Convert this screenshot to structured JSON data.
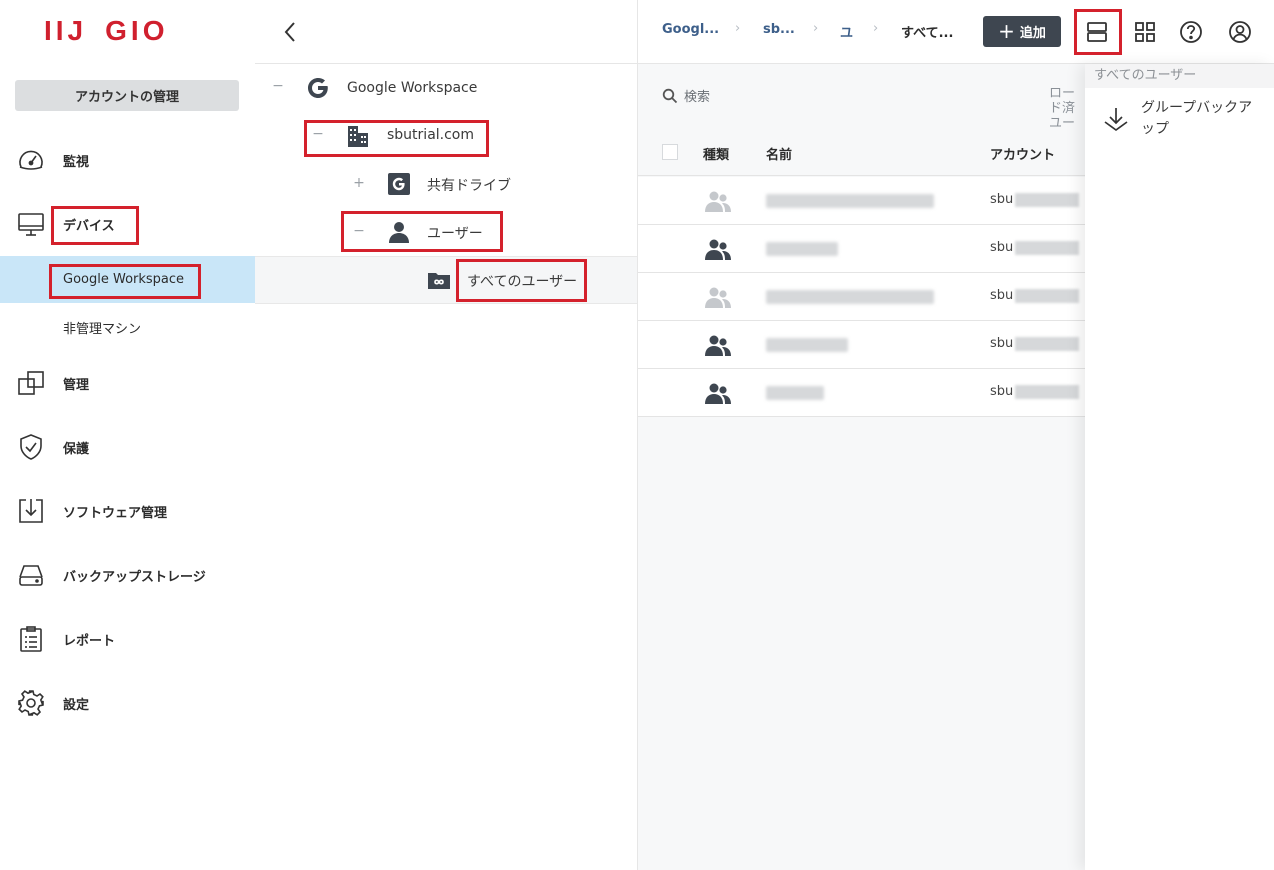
{
  "logo": {
    "part1": "IIJ",
    "part2": "GIO"
  },
  "sidebar": {
    "account_button": "アカウントの管理",
    "items": [
      {
        "label": "監視",
        "icon": "gauge-icon"
      },
      {
        "label": "デバイス",
        "icon": "monitor-icon"
      },
      {
        "label": "管理",
        "icon": "copy-icon"
      },
      {
        "label": "保護",
        "icon": "shield-icon"
      },
      {
        "label": "ソフトウェア管理",
        "icon": "download-box-icon"
      },
      {
        "label": "バックアップストレージ",
        "icon": "drive-icon"
      },
      {
        "label": "レポート",
        "icon": "clipboard-icon"
      },
      {
        "label": "設定",
        "icon": "gear-icon"
      }
    ],
    "device_sub": [
      {
        "label": "Google Workspace",
        "selected": true
      },
      {
        "label": "非管理マシン",
        "selected": false
      }
    ]
  },
  "tree": {
    "nodes": [
      {
        "label": "Google Workspace",
        "toggle": "−",
        "icon": "google-g-icon"
      },
      {
        "label": "sbutrial.com",
        "toggle": "−",
        "icon": "building-icon"
      },
      {
        "label": "共有ドライブ",
        "toggle": "+",
        "icon": "shared-drive-icon"
      },
      {
        "label": "ユーザー",
        "toggle": "−",
        "icon": "user-icon"
      },
      {
        "label": "すべてのユーザー",
        "toggle": "",
        "icon": "infinity-folder-icon"
      }
    ]
  },
  "breadcrumb": [
    "Googl...",
    "sb...",
    "ユ",
    "すべて..."
  ],
  "topbar": {
    "add_label": "追加"
  },
  "search": {
    "placeholder": "検索"
  },
  "table": {
    "column_cut": "ロード済ユーザ",
    "headers": [
      "種類",
      "名前",
      "アカウント"
    ],
    "rows": [
      {
        "active": false,
        "account_prefix": "sbu"
      },
      {
        "active": true,
        "account_prefix": "sbu"
      },
      {
        "active": false,
        "account_prefix": "sbu"
      },
      {
        "active": true,
        "account_prefix": "sbu"
      },
      {
        "active": true,
        "account_prefix": "sbu"
      }
    ]
  },
  "dropdown": {
    "header": "すべてのユーザー",
    "item_label": "グループバックアップ"
  },
  "colors": {
    "brand_red": "#d0202e",
    "highlight_red": "#d4212c",
    "selected_bg": "#c9e6f8",
    "add_button_bg": "#3e4650"
  }
}
